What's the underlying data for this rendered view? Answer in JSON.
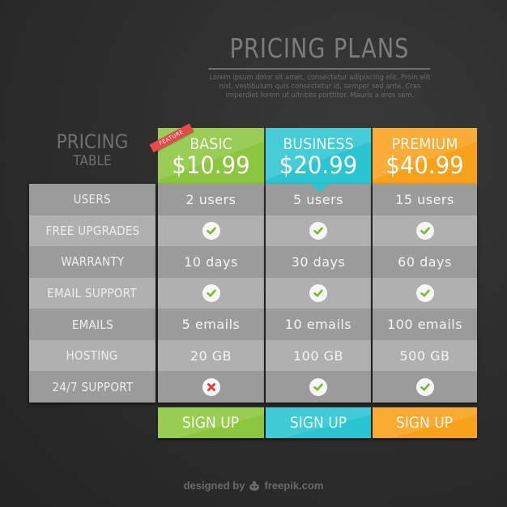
{
  "header": {
    "title": "PRICING PLANS",
    "subtitle": "Lorem ipsum dolor sit amet, consectetur adipiscing elit. Proin elit nisl, vestibulum quis consectetur id, semper sed ante. Cras imperdiet lorem ut ultrices porttitor. Mauris a eros sem."
  },
  "side_title": {
    "line1": "PRICING",
    "line2": "TABLE"
  },
  "ribbon": "FEATURE",
  "features": [
    "USERS",
    "FREE UPGRADES",
    "WARRANTY",
    "EMAIL SUPPORT",
    "EMAILS",
    "HOSTING",
    "24/7 SUPPORT"
  ],
  "plans": [
    {
      "name": "BASIC",
      "price": "$10.99",
      "color": "#8cc63f",
      "signup_label": "SIGN UP",
      "values": [
        {
          "type": "text",
          "text": "2 users"
        },
        {
          "type": "icon",
          "icon": "check-icon"
        },
        {
          "type": "text",
          "text": "10 days"
        },
        {
          "type": "icon",
          "icon": "check-icon"
        },
        {
          "type": "text",
          "text": "5 emails"
        },
        {
          "type": "text",
          "text": "20 GB"
        },
        {
          "type": "icon",
          "icon": "cross-icon"
        }
      ]
    },
    {
      "name": "BUSINESS",
      "price": "$20.99",
      "color": "#2bc5d1",
      "signup_label": "SIGN UP",
      "values": [
        {
          "type": "text",
          "text": "5 users"
        },
        {
          "type": "icon",
          "icon": "check-icon"
        },
        {
          "type": "text",
          "text": "30 days"
        },
        {
          "type": "icon",
          "icon": "check-icon"
        },
        {
          "type": "text",
          "text": "10 emails"
        },
        {
          "type": "text",
          "text": "100 GB"
        },
        {
          "type": "icon",
          "icon": "check-icon"
        }
      ]
    },
    {
      "name": "PREMIUM",
      "price": "$40.99",
      "color": "#f8a11b",
      "signup_label": "SIGN UP",
      "values": [
        {
          "type": "text",
          "text": "15 users"
        },
        {
          "type": "icon",
          "icon": "check-icon"
        },
        {
          "type": "text",
          "text": "60 days"
        },
        {
          "type": "icon",
          "icon": "check-icon"
        },
        {
          "type": "text",
          "text": "100 emails"
        },
        {
          "type": "text",
          "text": "500 GB"
        },
        {
          "type": "icon",
          "icon": "check-icon"
        }
      ]
    }
  ],
  "colors": {
    "check": "#7cbb30",
    "cross": "#e53935",
    "row_dark": "#9b9b9b",
    "row_light": "#b0b0b0"
  },
  "credit": {
    "prefix": "designed by",
    "brand": "freepik.com"
  }
}
